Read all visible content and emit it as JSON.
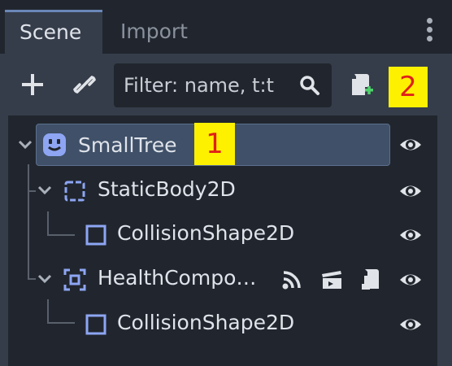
{
  "tabs": [
    {
      "label": "Scene",
      "active": true
    },
    {
      "label": "Import",
      "active": false
    }
  ],
  "toolbar": {
    "add_icon": "plus-icon",
    "link_icon": "link-icon",
    "filter_placeholder": "Filter: name, t:t",
    "search_icon": "search-icon",
    "attach_script_icon": "attach-script-icon"
  },
  "annotations": {
    "badge1": "1",
    "badge2": "2"
  },
  "tree": {
    "nodes": [
      {
        "name": "SmallTree",
        "icon": "node-root-face-icon",
        "selected": true
      },
      {
        "name": "StaticBody2D",
        "icon": "static-body-icon"
      },
      {
        "name": "CollisionShape2D",
        "icon": "collision-shape-icon"
      },
      {
        "name": "HealthCompo…",
        "icon": "health-component-icon",
        "extra_icons": [
          "signal-icon",
          "scene-clapper-icon",
          "script-icon"
        ]
      },
      {
        "name": "CollisionShape2D",
        "icon": "collision-shape-icon"
      }
    ]
  },
  "colors": {
    "accent": "#6b87b8",
    "node_icon": "#8da5f3",
    "selection": "#3f5068"
  }
}
